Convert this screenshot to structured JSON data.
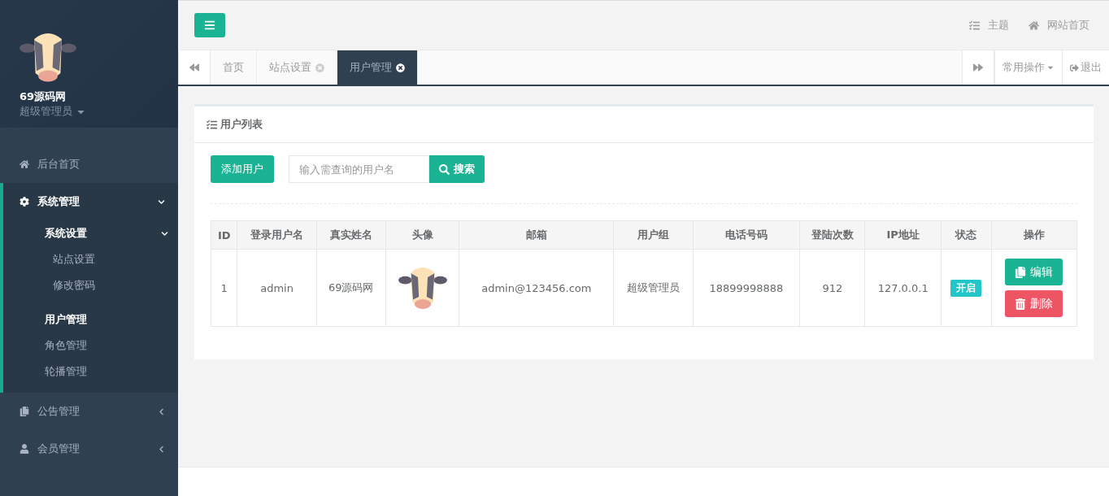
{
  "profile": {
    "name": "69源码网",
    "role": "超级管理员"
  },
  "menu": [
    {
      "label": "后台首页"
    },
    {
      "label": "系统管理",
      "expanded": true,
      "children": [
        {
          "label": "系统设置",
          "expanded": true,
          "children": [
            {
              "label": "站点设置",
              "selected": false
            },
            {
              "label": "修改密码",
              "selected": false
            }
          ]
        },
        {
          "label": "用户管理",
          "selected": true
        },
        {
          "label": "角色管理",
          "selected": false
        },
        {
          "label": "轮播管理",
          "selected": false
        }
      ]
    },
    {
      "label": "公告管理",
      "expanded": false
    },
    {
      "label": "会员管理",
      "expanded": false
    }
  ],
  "header_links": [
    "主题",
    "网站首页"
  ],
  "tabs": [
    {
      "label": "首页",
      "closable": false,
      "selected": false
    },
    {
      "label": "站点设置",
      "closable": true,
      "selected": false
    },
    {
      "label": "用户管理",
      "closable": true,
      "selected": true
    }
  ],
  "tab_actions": [
    {
      "kind": "dropdown",
      "label": "常用操作"
    },
    {
      "kind": "logout",
      "label": "退出"
    }
  ],
  "panel": {
    "title": "用户列表",
    "add_button": "添加用户",
    "search": {
      "placeholder": "输入需查询的用户名",
      "button": "搜索"
    }
  },
  "table": {
    "columns": [
      "ID",
      "登录用户名",
      "真实姓名",
      "头像",
      "邮箱",
      "用户组",
      "电话号码",
      "登陆次数",
      "IP地址",
      "状态",
      "操作"
    ],
    "rows": [
      [
        {
          "kind": "text",
          "text": "1"
        },
        {
          "kind": "text",
          "text": "admin"
        },
        {
          "kind": "text",
          "text": "69源码网"
        },
        {
          "kind": "avatar"
        },
        {
          "kind": "text",
          "text": "admin@123456.com"
        },
        {
          "kind": "text",
          "text": "超级管理员"
        },
        {
          "kind": "text",
          "text": "18899998888"
        },
        {
          "kind": "text",
          "text": "912"
        },
        {
          "kind": "text",
          "text": "127.0.0.1"
        },
        {
          "kind": "status",
          "text": "开启",
          "on": true
        },
        {
          "kind": "actions",
          "buttons": [
            {
              "kind": "edit",
              "label": "编辑"
            },
            {
              "kind": "delete",
              "label": "删除"
            }
          ]
        }
      ]
    ]
  }
}
